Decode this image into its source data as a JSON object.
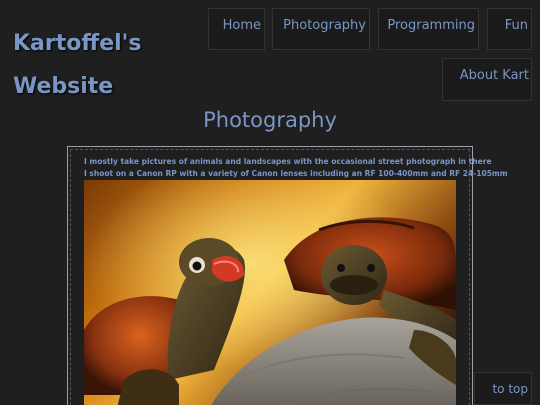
{
  "site": {
    "title_line1": "Kartoffel's",
    "title_line2": "Website"
  },
  "nav": {
    "home": "Home",
    "photography": "Photography",
    "programming": "Programming",
    "fun": "Fun",
    "about": "About Kart"
  },
  "page": {
    "heading": "Photography",
    "intro_line1": "I mostly take pictures of animals and landscapes with the occasional street photograph in there",
    "intro_line2": "I shoot on a Canon RP with a variety of Canon lenses including an RF 100-400mm and RF 24-105mm"
  },
  "footer": {
    "to_top": "to top"
  },
  "colors": {
    "accent": "#7a96c4",
    "background": "#1f1f1f"
  }
}
